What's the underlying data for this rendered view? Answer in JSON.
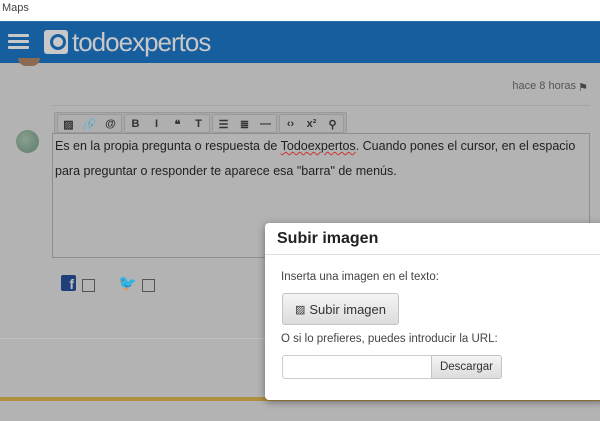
{
  "window": {
    "title": "Maps"
  },
  "header": {
    "brand": "todoexpertos",
    "brand_color": "#175e9f"
  },
  "post": {
    "timestamp": "hace 8 horas"
  },
  "toolbar": {
    "groups": [
      [
        {
          "icon": "image-icon",
          "glyph": "▨"
        },
        {
          "icon": "link-icon",
          "glyph": "🔗"
        },
        {
          "icon": "mention-icon",
          "glyph": "@"
        }
      ],
      [
        {
          "icon": "bold-icon",
          "glyph": "B"
        },
        {
          "icon": "italic-icon",
          "glyph": "I"
        },
        {
          "icon": "quote-icon",
          "glyph": "❝"
        },
        {
          "icon": "text-icon",
          "glyph": "T"
        }
      ],
      [
        {
          "icon": "bullet-list-icon",
          "glyph": "☰"
        },
        {
          "icon": "numbered-list-icon",
          "glyph": "≣"
        },
        {
          "icon": "horizontal-rule-icon",
          "glyph": "—"
        }
      ],
      [
        {
          "icon": "code-icon",
          "glyph": "‹›"
        },
        {
          "icon": "superscript-icon",
          "glyph": "x²"
        },
        {
          "icon": "location-icon",
          "glyph": "⚲"
        }
      ]
    ]
  },
  "editor": {
    "text_before": "Es en la propia pregunta o respuesta de ",
    "link_word": "Todoexpertos",
    "text_after": ". Cuando pones el cursor, en el espacio para preguntar o responder te aparece esa \"barra\" de menús."
  },
  "share": {
    "facebook": "f"
  },
  "modal": {
    "title": "Subir imagen",
    "insert_label": "Inserta una imagen en el texto:",
    "upload_button": "Subir imagen",
    "url_label": "O si lo prefieres, puedes introducir la URL:",
    "url_value": "",
    "download_button": "Descargar"
  }
}
